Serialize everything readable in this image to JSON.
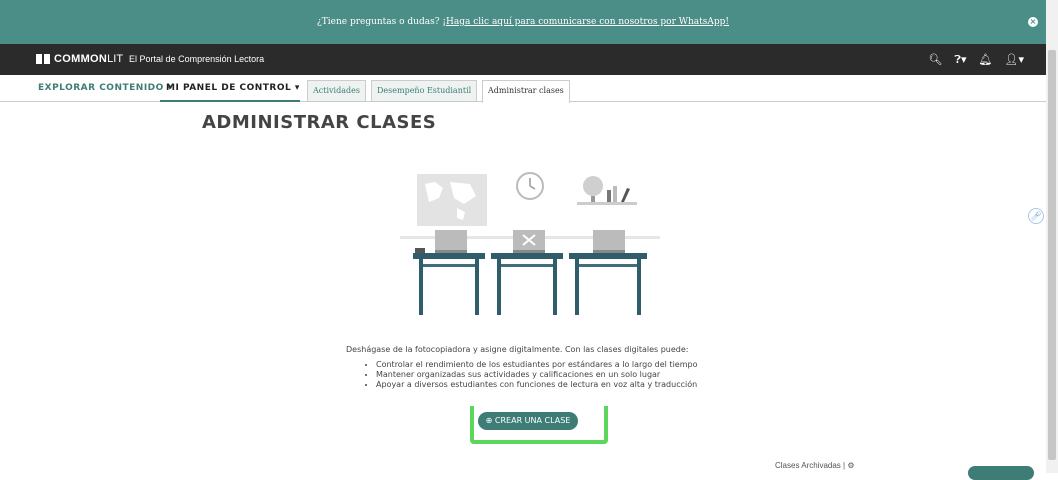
{
  "banner": {
    "text": "¿Tiene preguntas o dudas? ",
    "link": "¡Haga clic aquí para comunicarse con nosotros por WhatsApp!",
    "close_icon": "×"
  },
  "header": {
    "brand_bold": "COMMON",
    "brand_light": "LIT",
    "tagline": "El Portal de Comprensión Lectora",
    "icons": [
      "search-icon",
      "help-icon",
      "bell-icon",
      "user-icon"
    ]
  },
  "subnav": {
    "explorar": "EXPLORAR CONTENIDO ▾",
    "panel": "MI PANEL DE CONTROL ▾",
    "tabs": [
      "Actividades",
      "Desempeño Estudiantil",
      "Administrar clases"
    ]
  },
  "main": {
    "title": "ADMINISTRAR CLASES",
    "description": "Deshágase de la fotocopiadora y asigne digitalmente. Con las clases digitales puede:",
    "bullets": [
      "Controlar el rendimiento de los estudiantes por estándares a lo largo del tiempo",
      "Mantener organizadas sus actividades y calificaciones en un solo lugar",
      "Apoyar a diversos estudiantes con funciones de lectura en voz alta y traducción"
    ],
    "create_button": "CREAR UNA CLASE",
    "archived_link": "Clases Archivadas"
  },
  "colors": {
    "accent": "#3d7d76",
    "banner": "#4a8e87",
    "topbar": "#2b2b2b",
    "highlight": "#5cd65c"
  }
}
